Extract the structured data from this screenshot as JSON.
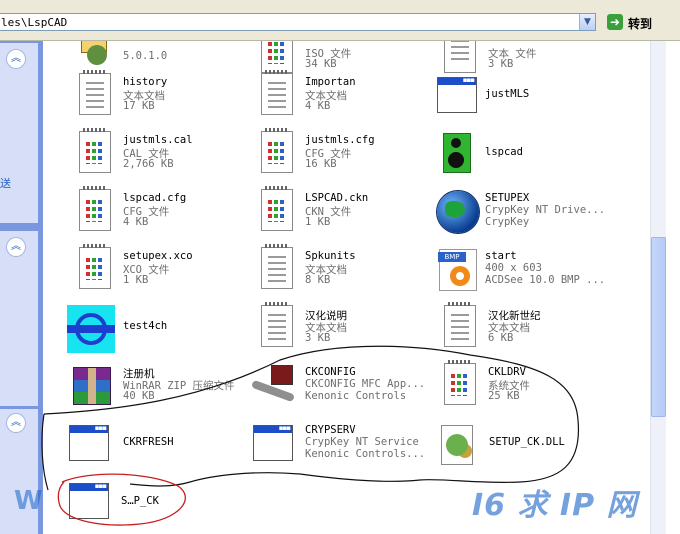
{
  "address_bar": {
    "path": "les\\LspCAD",
    "go_label": "转到"
  },
  "task_pane": {
    "collapse_glyph": "«",
    "link_text": "送"
  },
  "files": [
    {
      "name": "",
      "l2": "5.0.1.0",
      "l3": "",
      "icon": "gear-icon"
    },
    {
      "name": "",
      "l2": "ISO 文件",
      "l3": "34 KB",
      "icon": "document-icon"
    },
    {
      "name": "",
      "l2": "文本 文件",
      "l3": "3 KB",
      "icon": "document-icon"
    },
    {
      "name": "history",
      "l2": "文本文档",
      "l3": "17 KB",
      "icon": "text-document-icon"
    },
    {
      "name": "Importan",
      "l2": "文本文档",
      "l3": "4 KB",
      "icon": "text-document-icon"
    },
    {
      "name": "justMLS",
      "l2": "",
      "l3": "",
      "icon": "application-window-icon"
    },
    {
      "name": "justmls.cal",
      "l2": "CAL 文件",
      "l3": "2,766 KB",
      "icon": "document-icon"
    },
    {
      "name": "justmls.cfg",
      "l2": "CFG 文件",
      "l3": "16 KB",
      "icon": "document-icon"
    },
    {
      "name": "lspcad",
      "l2": "",
      "l3": "",
      "icon": "speaker-icon"
    },
    {
      "name": "lspcad.cfg",
      "l2": "CFG 文件",
      "l3": "4 KB",
      "icon": "document-icon"
    },
    {
      "name": "LSPCAD.ckn",
      "l2": "CKN 文件",
      "l3": "1 KB",
      "icon": "document-icon"
    },
    {
      "name": "SETUPEX",
      "l2": "CrypKey NT Drive...",
      "l3": "CrypKey",
      "icon": "globe-icon"
    },
    {
      "name": "setupex.xco",
      "l2": "XCO 文件",
      "l3": "1 KB",
      "icon": "document-icon"
    },
    {
      "name": "Spkunits",
      "l2": "文本文档",
      "l3": "8 KB",
      "icon": "text-document-icon"
    },
    {
      "name": "start",
      "l2": "400 x 603",
      "l3": "ACDSee 10.0 BMP ...",
      "icon": "bmp-image-icon"
    },
    {
      "name": "test4ch",
      "l2": "",
      "l3": "",
      "icon": "cyan-app-icon"
    },
    {
      "name": "汉化说明",
      "l2": "文本文档",
      "l3": "3 KB",
      "icon": "text-document-icon"
    },
    {
      "name": "汉化新世纪",
      "l2": "文本文档",
      "l3": "6 KB",
      "icon": "text-document-icon"
    },
    {
      "name": "注册机",
      "l2": "WinRAR ZIP 压缩文件",
      "l3": "40 KB",
      "icon": "winrar-archive-icon"
    },
    {
      "name": "CKCONFIG",
      "l2": "CKCONFIG MFC App...",
      "l3": "Kenonic Controls",
      "icon": "config-tool-icon"
    },
    {
      "name": "CKLDRV",
      "l2": "系统文件",
      "l3": "25 KB",
      "icon": "document-icon"
    },
    {
      "name": "CKRFRESH",
      "l2": "",
      "l3": "",
      "icon": "application-window-icon"
    },
    {
      "name": "CRYPSERV",
      "l2": "CrypKey NT Service",
      "l3": "Kenonic Controls...",
      "icon": "application-window-icon"
    },
    {
      "name": "SETUP_CK.DLL",
      "l2": "",
      "l3": "",
      "icon": "dll-icon"
    },
    {
      "name": "S…P_CK",
      "l2": "",
      "l3": "",
      "icon": "application-window-icon"
    }
  ],
  "watermarks": {
    "left": "W",
    "right": "I6 求 IP 网"
  }
}
